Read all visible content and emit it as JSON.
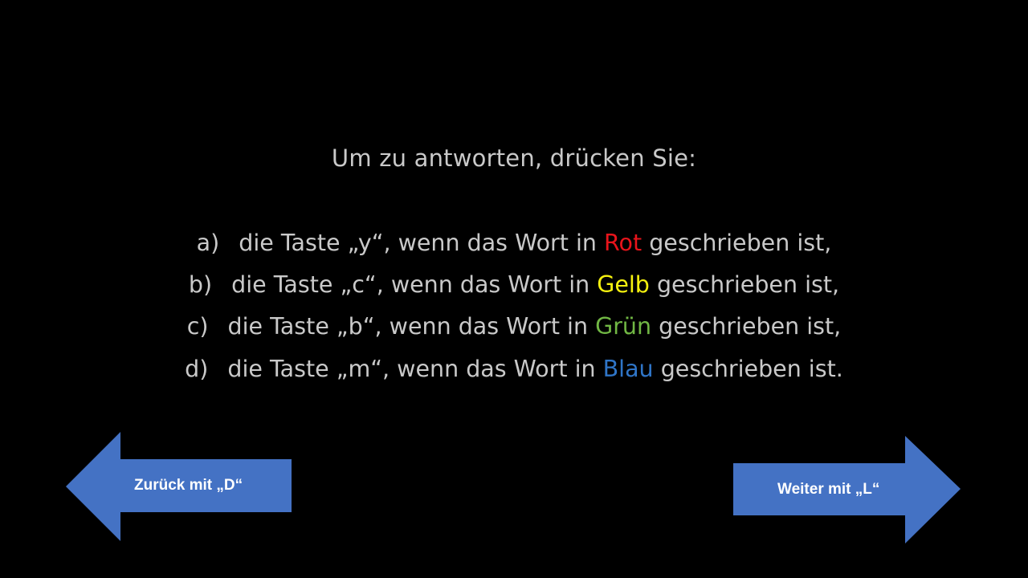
{
  "slide": {
    "heading": "Um zu antworten, drücken Sie:",
    "options": [
      {
        "marker": "a)",
        "before": "die Taste „y“, wenn das Wort  in",
        "color_word": "Rot",
        "after": "geschrieben ist,",
        "color": "#e8141b"
      },
      {
        "marker": "b)",
        "before": "die Taste „c“, wenn das Wort in",
        "color_word": "Gelb",
        "after": "geschrieben ist,",
        "color": "#f5f10f"
      },
      {
        "marker": "c)",
        "before": "die Taste „b“, wenn das Wort in",
        "color_word": "Grün",
        "after": "geschrieben ist,",
        "color": "#71b744"
      },
      {
        "marker": "d)",
        "before": "die Taste „m“, wenn das Wort in",
        "color_word": "Blau",
        "after": "geschrieben ist.",
        "color": "#2f75c7"
      }
    ]
  },
  "nav": {
    "back_label": "Zurück mit „D“",
    "next_label": "Weiter mit „L“",
    "arrow_color": "#4472c4",
    "icons": {
      "back": "arrow-left-icon",
      "next": "arrow-right-icon"
    }
  },
  "colors": {
    "background": "#000000",
    "text": "#c9c9c9"
  }
}
